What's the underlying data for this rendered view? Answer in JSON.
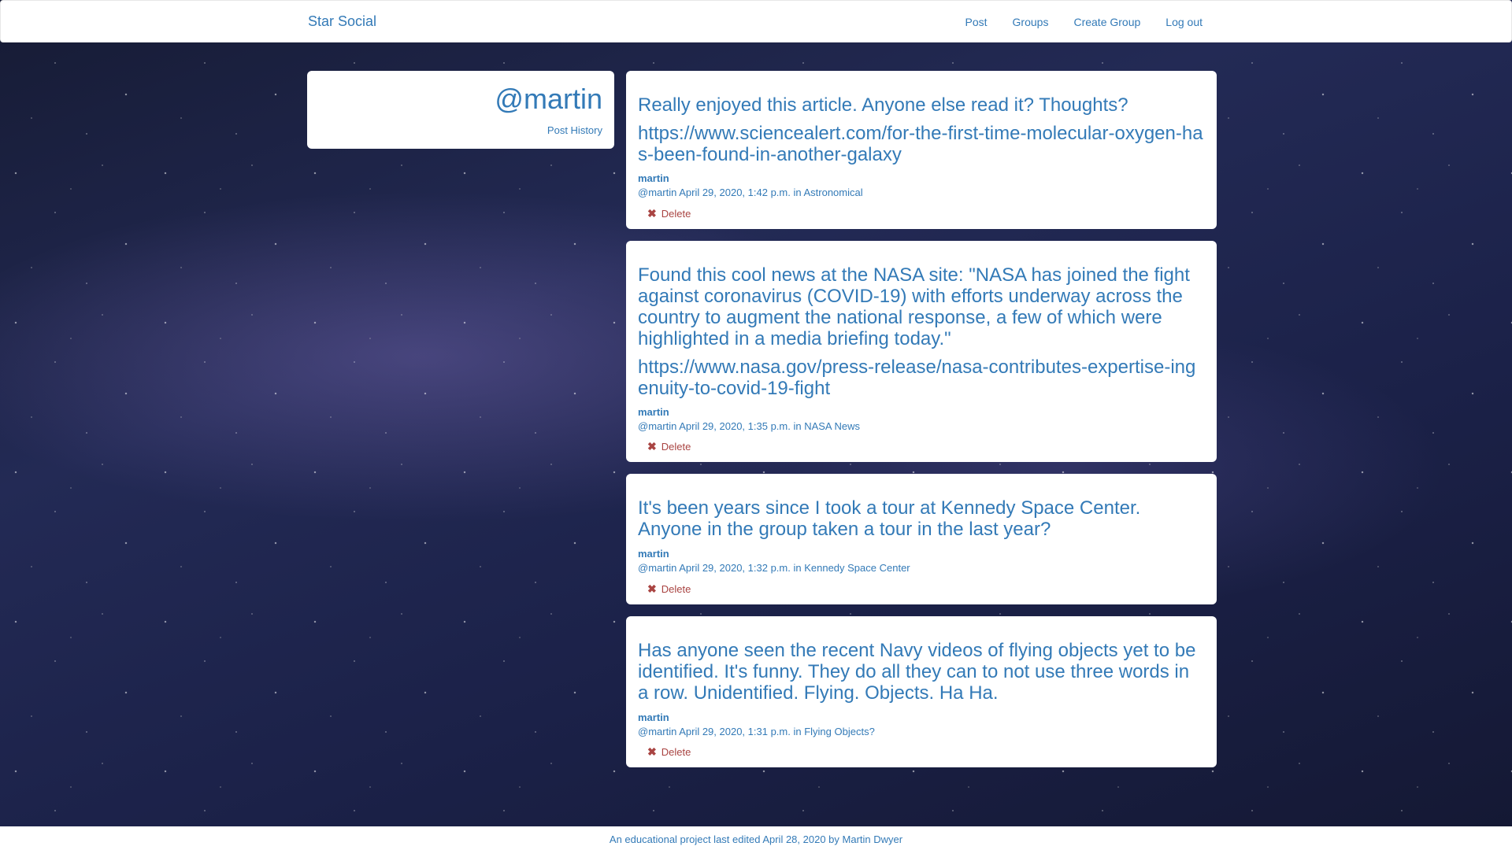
{
  "navbar": {
    "brand": "Star Social",
    "links": [
      "Post",
      "Groups",
      "Create Group",
      "Log out"
    ]
  },
  "profile": {
    "handle": "@martin",
    "history_label": "Post History"
  },
  "posts": [
    {
      "message": "Really enjoyed this article. Anyone else read it? Thoughts?",
      "link": "https://www.sciencealert.com/for-the-first-time-molecular-oxygen-has-been-found-in-another-galaxy",
      "user": "martin",
      "meta_prefix": "@martin April 29, 2020, 1:42 p.m. in ",
      "group": "Astronomical",
      "delete_label": "Delete"
    },
    {
      "message": "Found this cool news at the NASA site: \"NASA has joined the fight against coronavirus (COVID-19) with efforts underway across the country to augment the national response, a few of which were highlighted in a media briefing today.\"",
      "link": "https://www.nasa.gov/press-release/nasa-contributes-expertise-ingenuity-to-covid-19-fight",
      "user": "martin",
      "meta_prefix": "@martin April 29, 2020, 1:35 p.m. in ",
      "group": "NASA News",
      "delete_label": "Delete"
    },
    {
      "message": "It's been years since I took a tour at Kennedy Space Center. Anyone in the group taken a tour in the last year?",
      "link": "",
      "user": "martin",
      "meta_prefix": "@martin April 29, 2020, 1:32 p.m. in ",
      "group": "Kennedy Space Center",
      "delete_label": "Delete"
    },
    {
      "message": "Has anyone seen the recent Navy videos of flying objects yet to be identified. It's funny. They do all they can to not use three words in a row. Unidentified. Flying. Objects. Ha Ha.",
      "link": "",
      "user": "martin",
      "meta_prefix": "@martin April 29, 2020, 1:31 p.m. in ",
      "group": "Flying Objects?",
      "delete_label": "Delete"
    }
  ],
  "footer": {
    "text": "An educational project last edited April 28, 2020 by Martin Dwyer"
  }
}
